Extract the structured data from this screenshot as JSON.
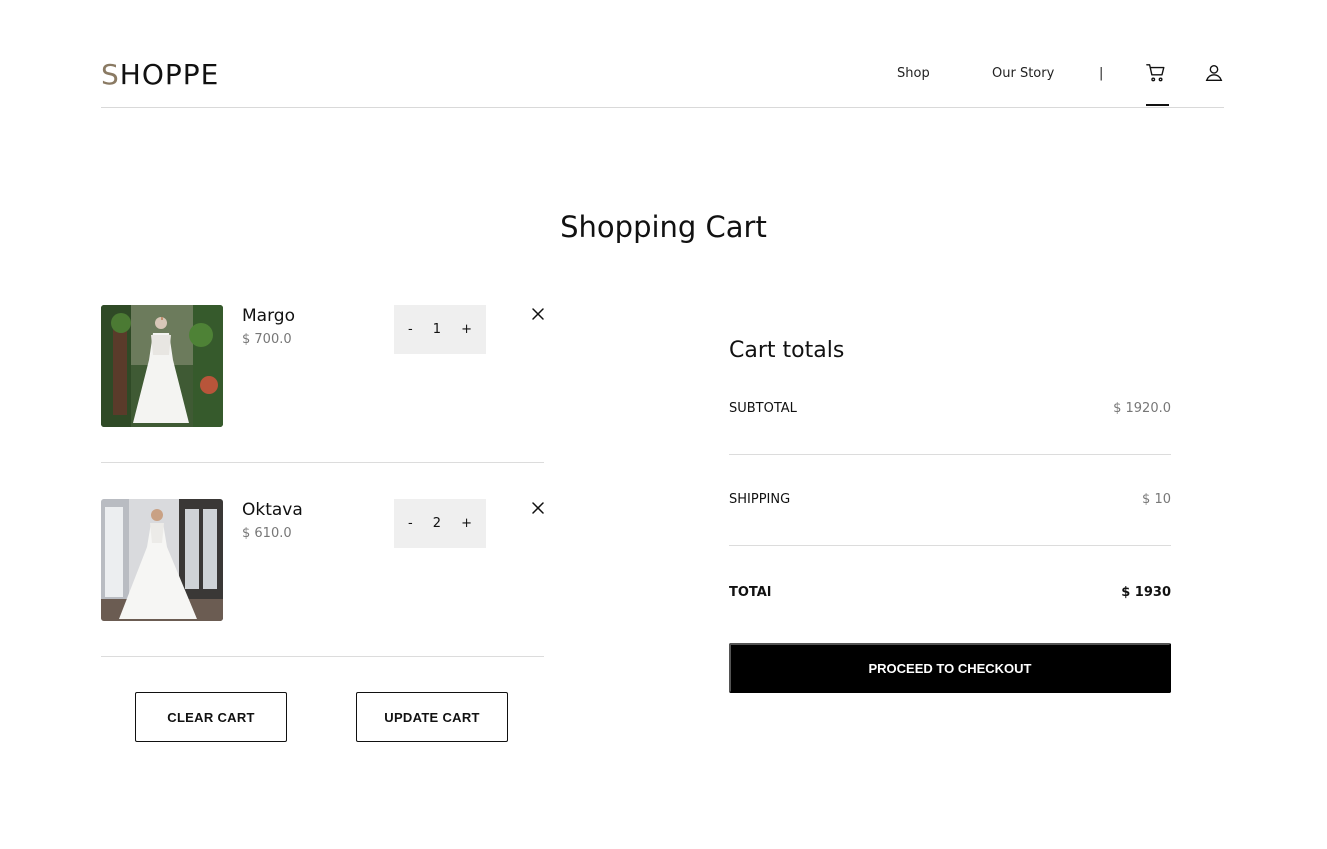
{
  "header": {
    "logo_first": "S",
    "logo_rest": "HOPPE",
    "nav": {
      "shop": "Shop",
      "our_story": "Our Story",
      "separator": "|"
    }
  },
  "page_title": "Shopping Cart",
  "cart": {
    "items": [
      {
        "name": "Margo",
        "price": "$ 700.0",
        "qty": "1",
        "minus": "-",
        "plus": "+"
      },
      {
        "name": "Oktava",
        "price": "$ 610.0",
        "qty": "2",
        "minus": "-",
        "plus": "+"
      }
    ],
    "clear_label": "CLEAR CART",
    "update_label": "UPDATE CART"
  },
  "totals": {
    "title": "Cart totals",
    "subtotal_label": "SUBTOTAL",
    "subtotal_value": "$ 1920.0",
    "shipping_label": "SHIPPING",
    "shipping_value": "$ 10",
    "total_label": "TOTAl",
    "total_value": "$ 1930",
    "checkout_label": "PROCEED TO CHECKOUT"
  },
  "colors": {
    "accent": "#000000",
    "logo_accent": "#8a7a63",
    "muted_text": "#777777",
    "qty_bg": "#efefef"
  }
}
